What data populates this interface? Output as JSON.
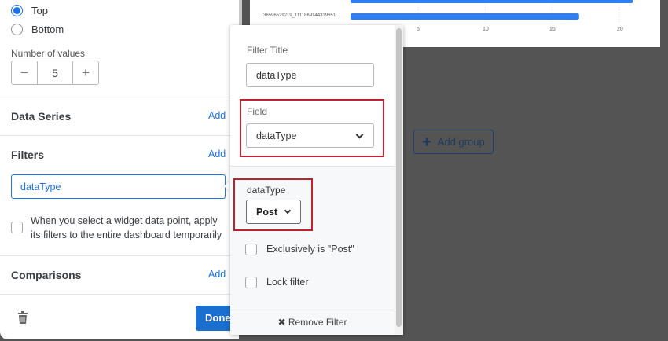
{
  "left_panel": {
    "sort_options": [
      {
        "label": "Top",
        "selected": true
      },
      {
        "label": "Bottom",
        "selected": false
      }
    ],
    "number_of_values_label": "Number of values",
    "number_of_values": "5",
    "minus": "−",
    "plus": "+",
    "data_series_title": "Data Series",
    "filters_title": "Filters",
    "comparisons_title": "Comparisons",
    "add_label": "Add",
    "filter_chip": "dataType",
    "apply_filters_text": "When you select a widget data point, apply its filters to the entire dashboard temporarily",
    "done_label": "Done"
  },
  "chart_data": {
    "type": "bar",
    "categories": [
      "",
      "36596529219_1111869144319651"
    ],
    "values": [
      21,
      17
    ],
    "x_ticks": [
      "5",
      "10",
      "15",
      "20"
    ],
    "xlim": [
      0,
      21.5
    ],
    "colors": {
      "bar": "#2f7ef5"
    }
  },
  "canvas": {
    "add_group_label": "Add group",
    "add_group_icon": "plus-icon"
  },
  "popover": {
    "filter_title_label": "Filter Title",
    "filter_title_value": "dataType",
    "field_label": "Field",
    "field_value": "dataType",
    "value_label": "dataType",
    "value_selected": "Post",
    "exclusively_label": "Exclusively is \"Post\"",
    "lock_label": "Lock filter",
    "remove_label": "Remove Filter",
    "remove_icon": "✖"
  },
  "colors": {
    "accent": "#1a73e8",
    "highlight": "#c0202f"
  }
}
